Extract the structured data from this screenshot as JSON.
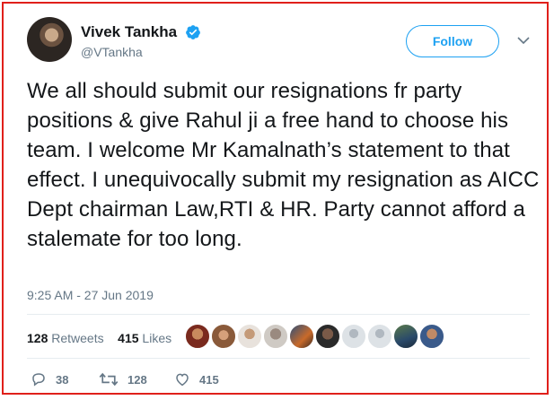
{
  "user": {
    "name": "Vivek Tankha",
    "handle": "@VTankha"
  },
  "header": {
    "follow_label": "Follow"
  },
  "tweet": {
    "text": "We all should submit our resignations fr party positions & give Rahul ji a free hand to choose his team. I welcome Mr Kamalnath’s statement to that effect. I unequivocally submit my resignation as AICC Dept chairman Law,RTI & HR. Party cannot afford a stalemate for too long.",
    "timestamp": "9:25 AM - 27 Jun 2019"
  },
  "stats": {
    "retweets_count": "128",
    "retweets_label": "Retweets",
    "likes_count": "415",
    "likes_label": "Likes"
  },
  "actions": {
    "replies": "38",
    "retweets": "128",
    "likes": "415"
  },
  "colors": {
    "accent": "#1da1f2",
    "frame": "#e0201b",
    "muted": "#657786",
    "text": "#14171a"
  }
}
